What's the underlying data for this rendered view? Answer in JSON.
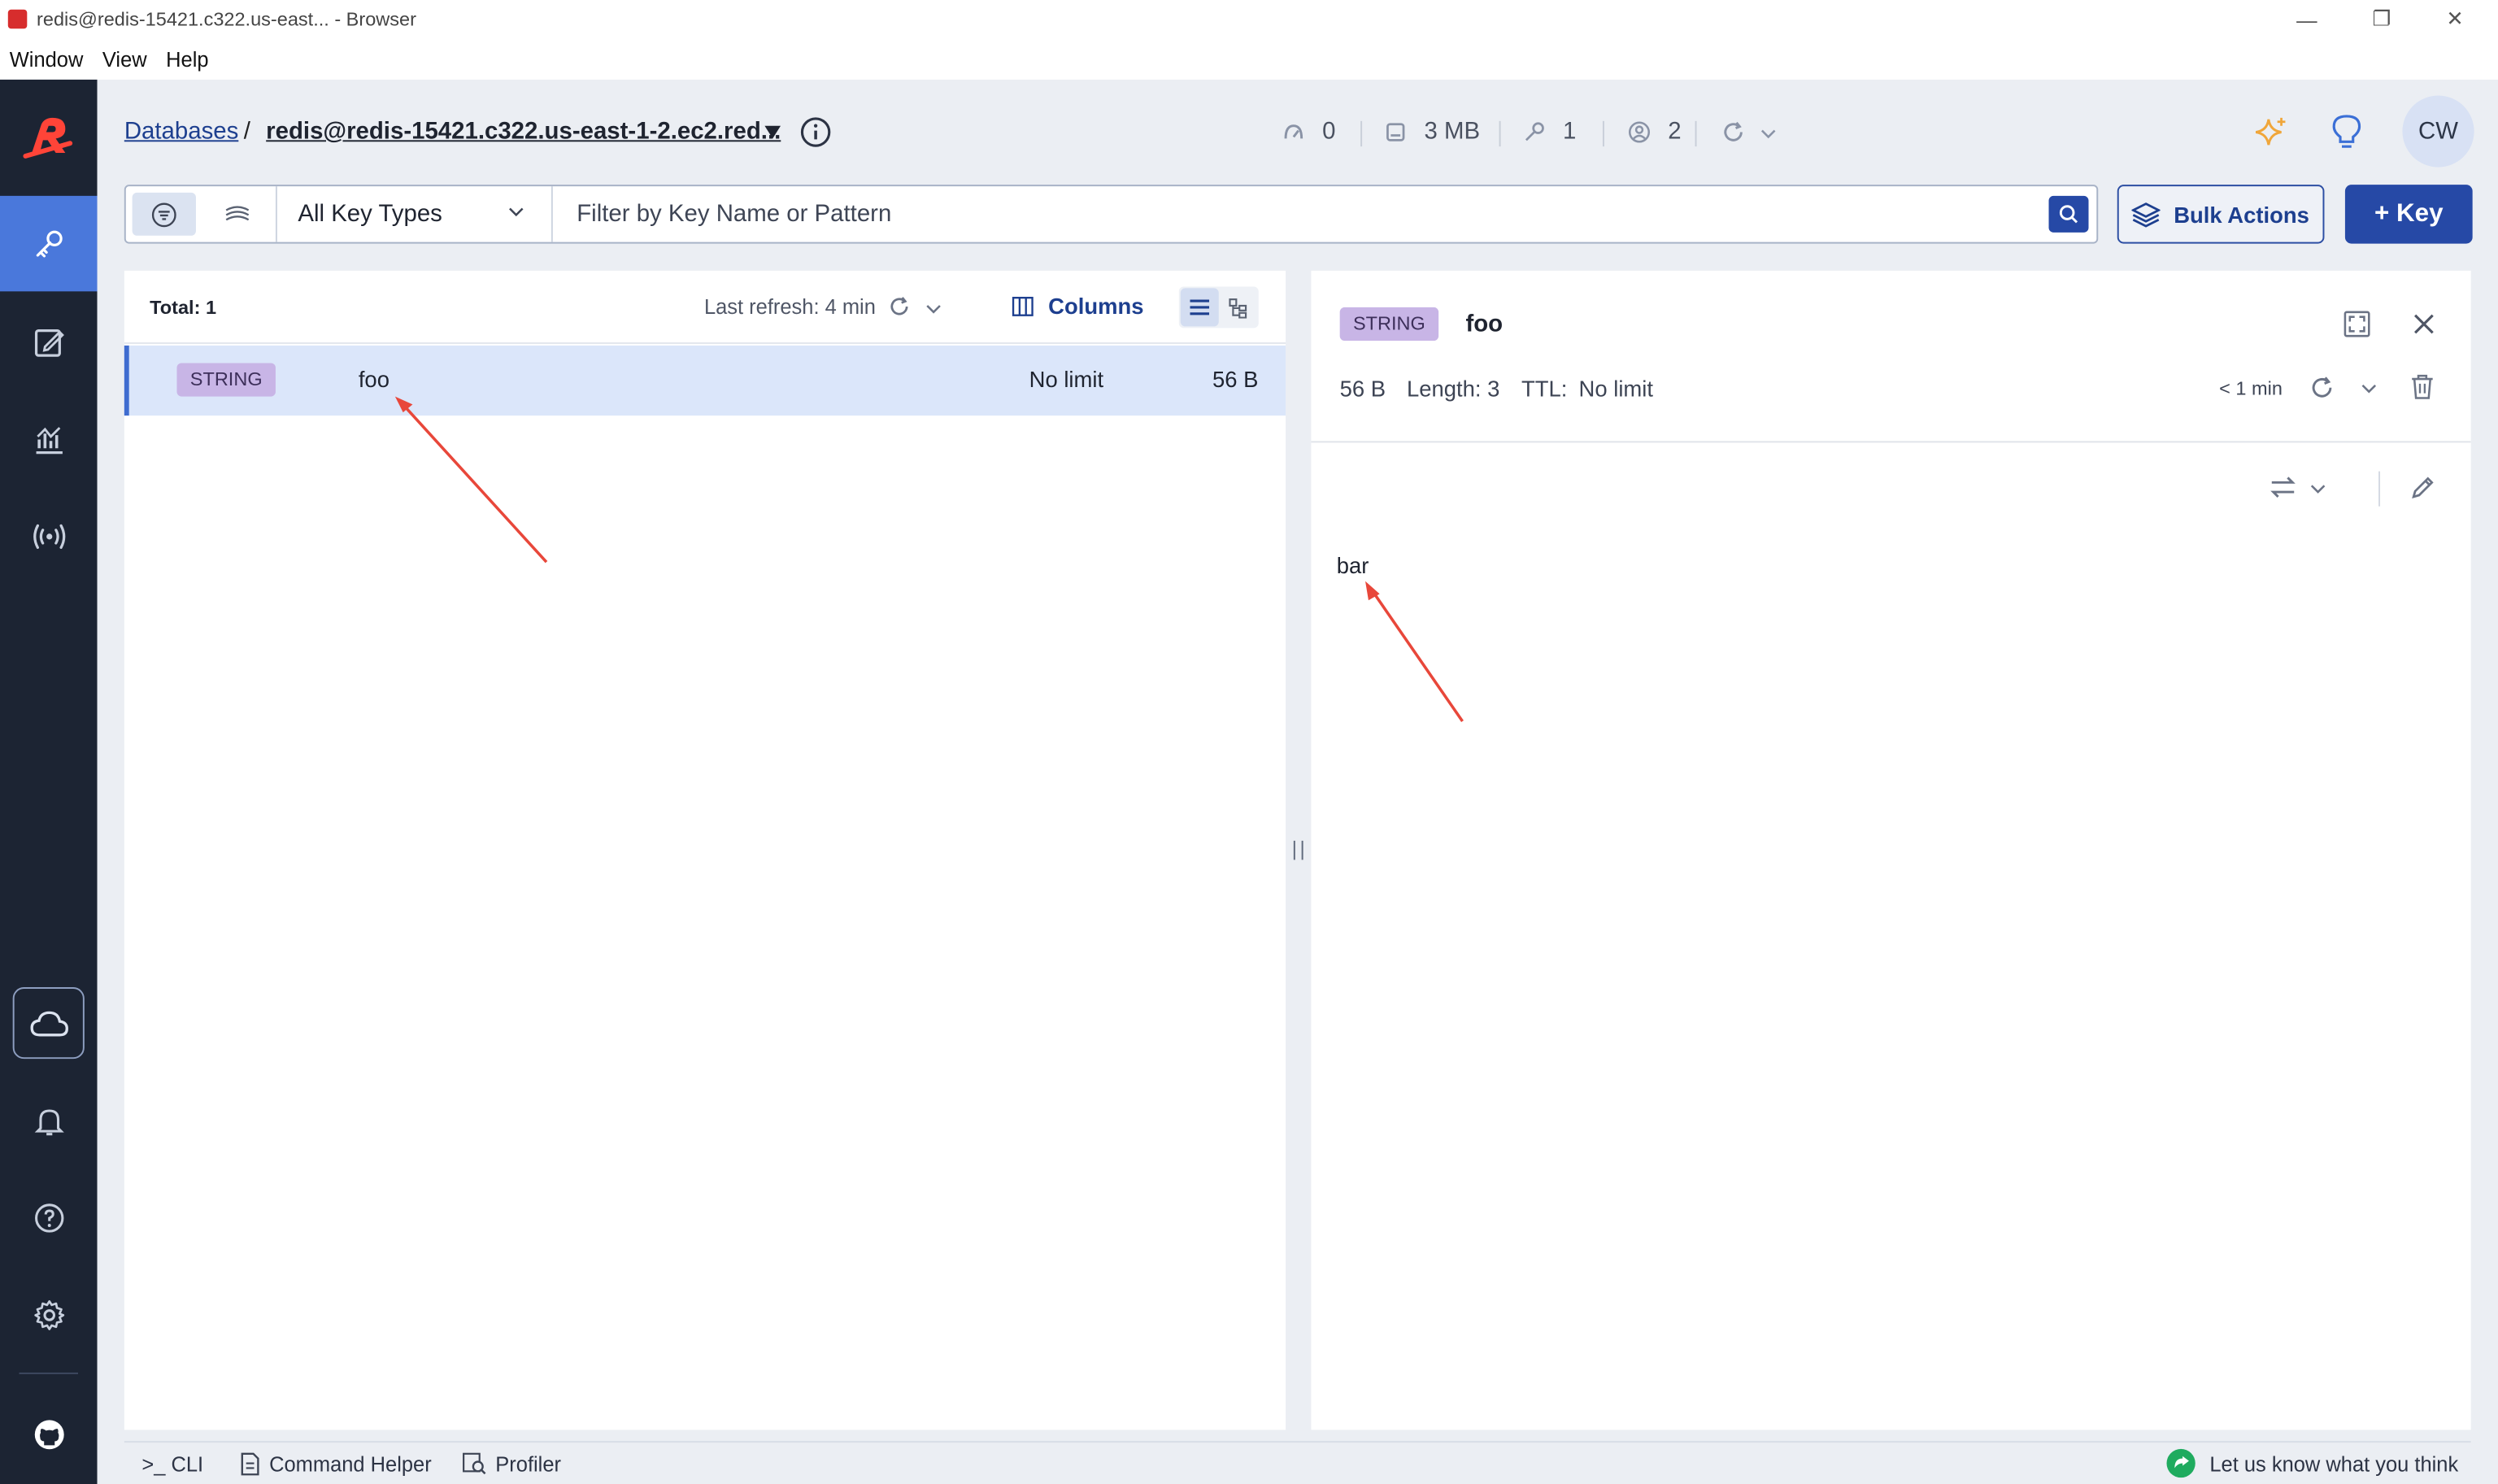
{
  "window": {
    "title": "redis@redis-15421.c322.us-east... - Browser",
    "menu": [
      "Window",
      "View",
      "Help"
    ],
    "controls": {
      "minimize": "—",
      "restore": "❐",
      "close": "✕"
    }
  },
  "nav": {
    "items": [
      "browser-icon",
      "workbench-icon",
      "analytics-icon",
      "pubsub-icon"
    ],
    "bottom": [
      "cloud-icon",
      "notifications-icon",
      "help-icon",
      "settings-icon",
      "github-icon"
    ]
  },
  "header": {
    "breadcrumb_root": "Databases",
    "breadcrumb_sep": "/",
    "database_name": "redis@redis-15421.c322.us-east-1-2.ec2.red...",
    "stats": {
      "ops": "0",
      "memory": "3 MB",
      "keys": "1",
      "clients": "2"
    }
  },
  "filter": {
    "key_type": "All Key Types",
    "search_placeholder": "Filter by Key Name or Pattern",
    "bulk_actions_label": "Bulk Actions",
    "add_key_label": "+ Key"
  },
  "key_list": {
    "total_label": "Total: 1",
    "last_refresh": "Last refresh: 4 min",
    "columns_label": "Columns",
    "rows": [
      {
        "type": "STRING",
        "name": "foo",
        "ttl": "No limit",
        "size": "56 B"
      }
    ]
  },
  "details": {
    "type": "STRING",
    "key": "foo",
    "size": "56 B",
    "length": "Length: 3",
    "ttl_label": "TTL:",
    "ttl_value": "No limit",
    "last_refresh": "< 1 min",
    "value": "bar"
  },
  "bottom_bar": {
    "cli": ">_ CLI",
    "command_helper": "Command Helper",
    "profiler": "Profiler",
    "feedback": "Let us know what you think"
  },
  "colors": {
    "nav_bg": "#1c2433",
    "nav_active": "#4a78db",
    "primary": "#2649a6",
    "string_badge": "#c8b5e6",
    "selected_row": "#dbe6fa",
    "annotation": "#e8473a",
    "feedback_green": "#1fab5f"
  }
}
